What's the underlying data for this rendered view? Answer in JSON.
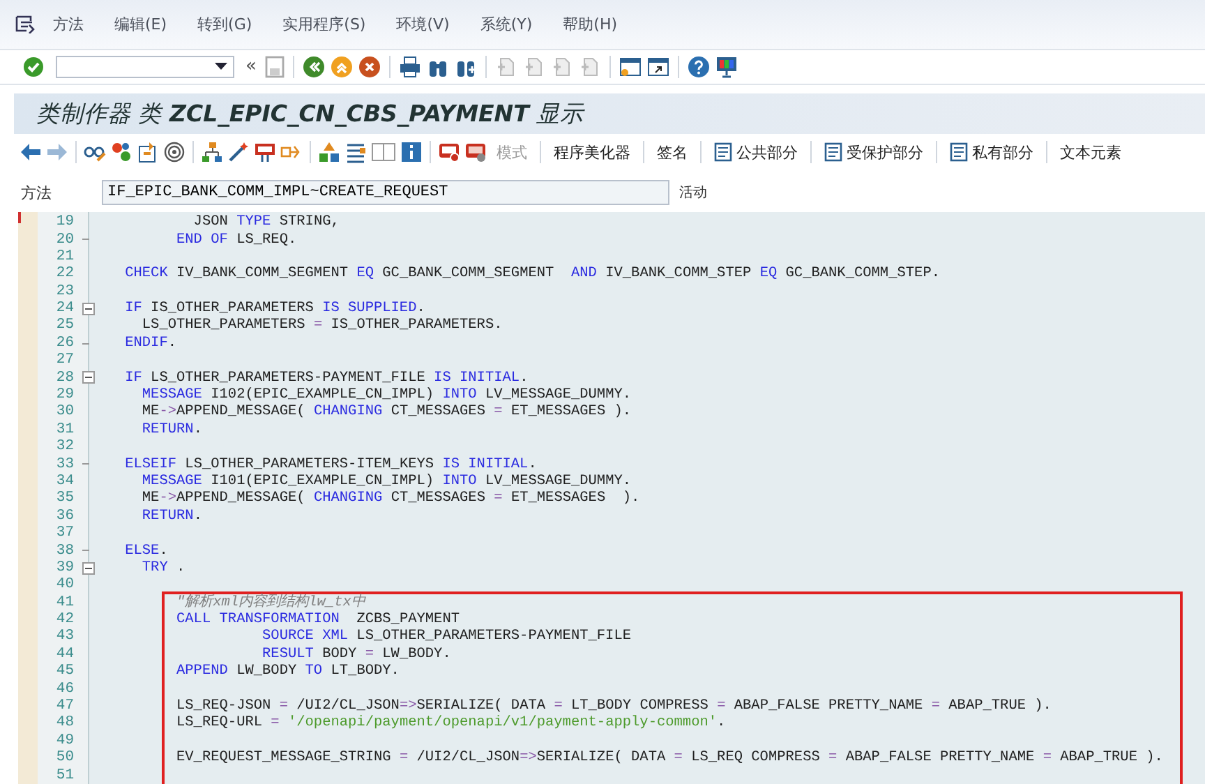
{
  "menu_bar": {
    "items": [
      {
        "label": "方法"
      },
      {
        "label": "编辑(E)"
      },
      {
        "label": "转到(G)"
      },
      {
        "label": "实用程序(S)"
      },
      {
        "label": "环境(V)"
      },
      {
        "label": "系统(Y)"
      },
      {
        "label": "帮助(H)"
      }
    ]
  },
  "standard_toolbar": {
    "collapse_glyph": "«"
  },
  "title": "类制作器 类 **ZCL_EPIC_CN_CBS_PAYMENT** 显示",
  "app_toolbar": {
    "buttons": [
      {
        "label": "模式",
        "disabled": true,
        "kind": "text"
      },
      {
        "label": "程序美化器",
        "disabled": false,
        "kind": "text"
      },
      {
        "label": "签名",
        "disabled": false,
        "kind": "text"
      },
      {
        "label": "公共部分",
        "disabled": false,
        "kind": "icon-text"
      },
      {
        "label": "受保护部分",
        "disabled": false,
        "kind": "icon-text"
      },
      {
        "label": "私有部分",
        "disabled": false,
        "kind": "icon-text"
      },
      {
        "label": "文本元素",
        "disabled": false,
        "kind": "text"
      }
    ]
  },
  "method_row": {
    "label": "方法",
    "value": "IF_EPIC_BANK_COMM_IMPL~CREATE_REQUEST",
    "status": "活动"
  },
  "editor": {
    "lines": [
      {
        "number": "19",
        "collapsible": false,
        "block_end": false,
        "segments": [
          {
            "kind": "plain",
            "text": "            JSON "
          },
          {
            "kind": "keyword",
            "text": "TYPE"
          },
          {
            "kind": "plain",
            "text": " STRING,"
          }
        ]
      },
      {
        "number": "20",
        "collapsible": false,
        "block_end": true,
        "segments": [
          {
            "kind": "keyword",
            "text": "          END OF"
          },
          {
            "kind": "plain",
            "text": " LS_REQ."
          }
        ]
      },
      {
        "number": "21",
        "collapsible": false,
        "block_end": false
      },
      {
        "number": "22",
        "collapsible": false,
        "block_end": false,
        "segments": [
          {
            "kind": "keyword",
            "text": "    CHECK"
          },
          {
            "kind": "plain",
            "text": " IV_BANK_COMM_SEGMENT "
          },
          {
            "kind": "keyword",
            "text": "EQ"
          },
          {
            "kind": "plain",
            "text": " GC_BANK_COMM_SEGMENT  "
          },
          {
            "kind": "keyword",
            "text": "AND"
          },
          {
            "kind": "plain",
            "text": " IV_BANK_COMM_STEP "
          },
          {
            "kind": "keyword",
            "text": "EQ"
          },
          {
            "kind": "plain",
            "text": " GC_BANK_COMM_STEP."
          }
        ]
      },
      {
        "number": "23",
        "collapsible": false,
        "block_end": false
      },
      {
        "number": "24",
        "collapsible": true,
        "block_end": false,
        "segments": [
          {
            "kind": "keyword",
            "text": "    IF"
          },
          {
            "kind": "plain",
            "text": " IS_OTHER_PARAMETERS "
          },
          {
            "kind": "keyword",
            "text": "IS SUPPLIED"
          },
          {
            "kind": "plain",
            "text": "."
          }
        ]
      },
      {
        "number": "25",
        "collapsible": false,
        "block_end": false,
        "segments": [
          {
            "kind": "plain",
            "text": "      LS_OTHER_PARAMETERS "
          },
          {
            "kind": "operator",
            "text": "="
          },
          {
            "kind": "plain",
            "text": " IS_OTHER_PARAMETERS."
          }
        ]
      },
      {
        "number": "26",
        "collapsible": false,
        "block_end": true,
        "segments": [
          {
            "kind": "keyword",
            "text": "    ENDIF"
          },
          {
            "kind": "plain",
            "text": "."
          }
        ]
      },
      {
        "number": "27",
        "collapsible": false,
        "block_end": false
      },
      {
        "number": "28",
        "collapsible": true,
        "block_end": false,
        "segments": [
          {
            "kind": "keyword",
            "text": "    IF"
          },
          {
            "kind": "plain",
            "text": " LS_OTHER_PARAMETERS-PAYMENT_FILE "
          },
          {
            "kind": "keyword",
            "text": "IS INITIAL"
          },
          {
            "kind": "plain",
            "text": "."
          }
        ]
      },
      {
        "number": "29",
        "collapsible": false,
        "block_end": false,
        "segments": [
          {
            "kind": "keyword",
            "text": "      MESSAGE"
          },
          {
            "kind": "plain",
            "text": " I102(EPIC_EXAMPLE_CN_IMPL) "
          },
          {
            "kind": "keyword",
            "text": "INTO"
          },
          {
            "kind": "plain",
            "text": " LV_MESSAGE_DUMMY."
          }
        ]
      },
      {
        "number": "30",
        "collapsible": false,
        "block_end": false,
        "segments": [
          {
            "kind": "plain",
            "text": "      ME"
          },
          {
            "kind": "operator",
            "text": "->"
          },
          {
            "kind": "plain",
            "text": "APPEND_MESSAGE( "
          },
          {
            "kind": "keyword",
            "text": "CHANGING"
          },
          {
            "kind": "plain",
            "text": " CT_MESSAGES "
          },
          {
            "kind": "operator",
            "text": "="
          },
          {
            "kind": "plain",
            "text": " ET_MESSAGES )."
          }
        ]
      },
      {
        "number": "31",
        "collapsible": false,
        "block_end": false,
        "segments": [
          {
            "kind": "keyword",
            "text": "      RETURN"
          },
          {
            "kind": "plain",
            "text": "."
          }
        ]
      },
      {
        "number": "32",
        "collapsible": false,
        "block_end": false
      },
      {
        "number": "33",
        "collapsible": false,
        "block_end": true,
        "segments": [
          {
            "kind": "keyword",
            "text": "    ELSEIF"
          },
          {
            "kind": "plain",
            "text": " LS_OTHER_PARAMETERS-ITEM_KEYS "
          },
          {
            "kind": "keyword",
            "text": "IS INITIAL"
          },
          {
            "kind": "plain",
            "text": "."
          }
        ]
      },
      {
        "number": "34",
        "collapsible": false,
        "block_end": false,
        "segments": [
          {
            "kind": "keyword",
            "text": "      MESSAGE"
          },
          {
            "kind": "plain",
            "text": " I101(EPIC_EXAMPLE_CN_IMPL) "
          },
          {
            "kind": "keyword",
            "text": "INTO"
          },
          {
            "kind": "plain",
            "text": " LV_MESSAGE_DUMMY."
          }
        ]
      },
      {
        "number": "35",
        "collapsible": false,
        "block_end": false,
        "segments": [
          {
            "kind": "plain",
            "text": "      ME"
          },
          {
            "kind": "operator",
            "text": "->"
          },
          {
            "kind": "plain",
            "text": "APPEND_MESSAGE( "
          },
          {
            "kind": "keyword",
            "text": "CHANGING"
          },
          {
            "kind": "plain",
            "text": " CT_MESSAGES "
          },
          {
            "kind": "operator",
            "text": "="
          },
          {
            "kind": "plain",
            "text": " ET_MESSAGES  )."
          }
        ]
      },
      {
        "number": "36",
        "collapsible": false,
        "block_end": false,
        "segments": [
          {
            "kind": "keyword",
            "text": "      RETURN"
          },
          {
            "kind": "plain",
            "text": "."
          }
        ]
      },
      {
        "number": "37",
        "collapsible": false,
        "block_end": false
      },
      {
        "number": "38",
        "collapsible": false,
        "block_end": true,
        "segments": [
          {
            "kind": "keyword",
            "text": "    ELSE"
          },
          {
            "kind": "plain",
            "text": "."
          }
        ]
      },
      {
        "number": "39",
        "collapsible": true,
        "block_end": false,
        "segments": [
          {
            "kind": "keyword",
            "text": "      TRY"
          },
          {
            "kind": "plain",
            "text": " ."
          }
        ]
      },
      {
        "number": "40",
        "collapsible": false,
        "block_end": false
      }
    ],
    "highlight_box": {
      "lines": [
        {
          "number": "41",
          "collapsible": false,
          "block_end": false,
          "segments": [
            {
              "kind": "comment",
              "text": "          \"解析xml内容到结构lw_tx中"
            }
          ]
        },
        {
          "number": "42",
          "collapsible": false,
          "block_end": false,
          "segments": [
            {
              "kind": "keyword",
              "text": "          CALL TRANSFORMATION"
            },
            {
              "kind": "plain",
              "text": "  ZCBS_PAYMENT"
            }
          ]
        },
        {
          "number": "43",
          "collapsible": false,
          "block_end": false,
          "segments": [
            {
              "kind": "keyword",
              "text": "                    SOURCE XML"
            },
            {
              "kind": "plain",
              "text": " LS_OTHER_PARAMETERS-PAYMENT_FILE"
            }
          ]
        },
        {
          "number": "44",
          "collapsible": false,
          "block_end": false,
          "segments": [
            {
              "kind": "keyword",
              "text": "                    RESULT"
            },
            {
              "kind": "plain",
              "text": " BODY "
            },
            {
              "kind": "operator",
              "text": "="
            },
            {
              "kind": "plain",
              "text": " LW_BODY."
            }
          ]
        },
        {
          "number": "45",
          "collapsible": false,
          "block_end": false,
          "segments": [
            {
              "kind": "keyword",
              "text": "          APPEND"
            },
            {
              "kind": "plain",
              "text": " LW_BODY "
            },
            {
              "kind": "keyword",
              "text": "TO"
            },
            {
              "kind": "plain",
              "text": " LT_BODY."
            }
          ]
        },
        {
          "number": "46",
          "collapsible": false,
          "block_end": false
        },
        {
          "number": "47",
          "collapsible": false,
          "block_end": false,
          "segments": [
            {
              "kind": "plain",
              "text": "          LS_REQ-JSON "
            },
            {
              "kind": "operator",
              "text": "="
            },
            {
              "kind": "plain",
              "text": " /UI2/CL_JSON"
            },
            {
              "kind": "operator",
              "text": "=>"
            },
            {
              "kind": "plain",
              "text": "SERIALIZE( DATA "
            },
            {
              "kind": "operator",
              "text": "="
            },
            {
              "kind": "plain",
              "text": " LT_BODY COMPRESS "
            },
            {
              "kind": "operator",
              "text": "="
            },
            {
              "kind": "plain",
              "text": " ABAP_FALSE PRETTY_NAME "
            },
            {
              "kind": "operator",
              "text": "="
            },
            {
              "kind": "plain",
              "text": " ABAP_TRUE )."
            }
          ]
        },
        {
          "number": "48",
          "collapsible": false,
          "block_end": false,
          "segments": [
            {
              "kind": "plain",
              "text": "          LS_REQ-URL "
            },
            {
              "kind": "operator",
              "text": "="
            },
            {
              "kind": "string",
              "text": " '/openapi/payment/openapi/v1/payment-apply-common'"
            },
            {
              "kind": "plain",
              "text": "."
            }
          ]
        },
        {
          "number": "49",
          "collapsible": false,
          "block_end": false
        },
        {
          "number": "50",
          "collapsible": false,
          "block_end": false,
          "segments": [
            {
              "kind": "plain",
              "text": "          EV_REQUEST_MESSAGE_STRING "
            },
            {
              "kind": "operator",
              "text": "="
            },
            {
              "kind": "plain",
              "text": " /UI2/CL_JSON"
            },
            {
              "kind": "operator",
              "text": "=>"
            },
            {
              "kind": "plain",
              "text": "SERIALIZE( DATA "
            },
            {
              "kind": "operator",
              "text": "="
            },
            {
              "kind": "plain",
              "text": " LS_REQ COMPRESS "
            },
            {
              "kind": "operator",
              "text": "="
            },
            {
              "kind": "plain",
              "text": " ABAP_FALSE PRETTY_NAME "
            },
            {
              "kind": "operator",
              "text": "="
            },
            {
              "kind": "plain",
              "text": " ABAP_TRUE )."
            }
          ]
        },
        {
          "number": "51",
          "collapsible": false,
          "block_end": false
        }
      ]
    }
  }
}
